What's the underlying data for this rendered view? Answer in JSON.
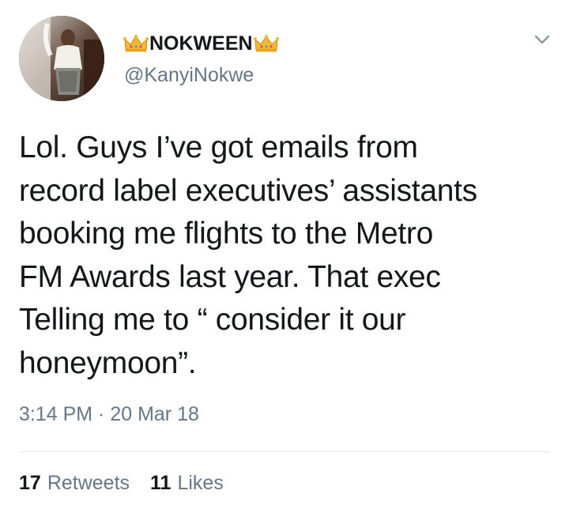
{
  "tweet": {
    "author": {
      "display_name": "NOKWEEN",
      "handle": "@KanyiNokwe",
      "name_decoration_icon": "crown-icon"
    },
    "text": "Lol.  Guys I’ve got emails from\nrecord label executives’ assistants\nbooking me flights to the Metro\nFM Awards last year. That exec\nTelling me to  “ consider it our\nhoneymoon”.",
    "timestamp": "3:14 PM · 20 Mar 18",
    "stats": {
      "retweets_count": "17",
      "retweets_label": "Retweets",
      "likes_count": "11",
      "likes_label": "Likes"
    }
  },
  "colors": {
    "primary_text": "#14171a",
    "secondary_text": "#657786",
    "divider": "#e1e8ed",
    "crown": "#f5b82e"
  },
  "icons": {
    "menu": "chevron-down-icon",
    "crown": "crown-icon"
  }
}
